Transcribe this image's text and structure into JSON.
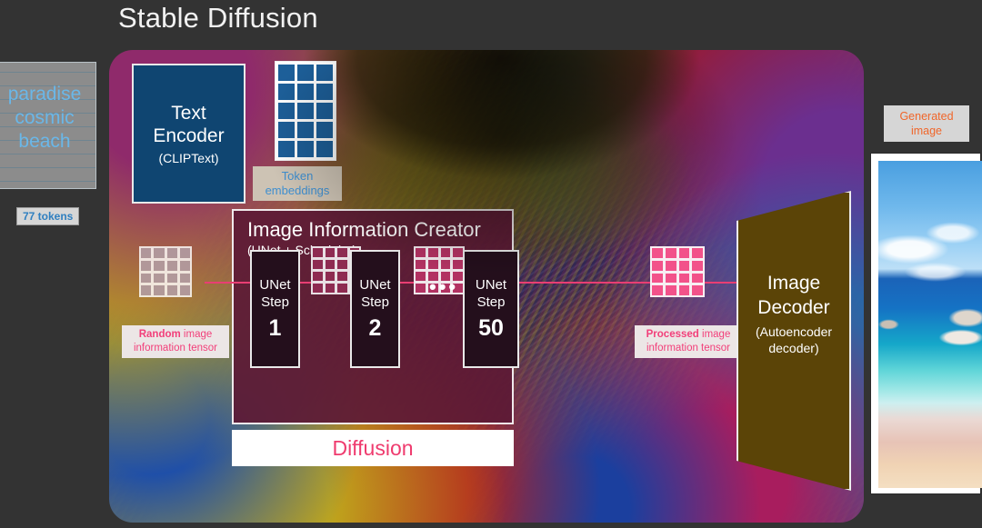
{
  "title": "Stable Diffusion",
  "prompt": {
    "text": "paradise cosmic beach",
    "tokens_badge": "77 tokens"
  },
  "text_encoder": {
    "line1": "Text",
    "line2": "Encoder",
    "subtitle": "(CLIPText)"
  },
  "token_embeddings": {
    "label": "Token embeddings",
    "cols": 3,
    "rows": 5
  },
  "image_information_creator": {
    "title": "Image Information Creator",
    "subtitle": "(UNet + Scheduler)",
    "unet_steps": [
      {
        "line1": "UNet",
        "line2": "Step",
        "number": "1"
      },
      {
        "line1": "UNet",
        "line2": "Step",
        "number": "2"
      },
      {
        "line1": "UNet",
        "line2": "Step",
        "number": "50"
      }
    ],
    "ellipsis": "•••",
    "diffusion_bar": "Diffusion"
  },
  "tensors": {
    "random": {
      "emphasis": "Random",
      "rest": " image information tensor",
      "cols": 4,
      "rows": 4
    },
    "processed": {
      "emphasis": "Processed",
      "rest": " image information tensor",
      "cols": 4,
      "rows": 4
    },
    "latent_cols": 4,
    "latent_rows": 4
  },
  "image_decoder": {
    "line1": "Image",
    "line2": "Decoder",
    "sub1": "(Autoencoder",
    "sub2": "decoder)"
  },
  "generated": {
    "label": "Generated image"
  },
  "colors": {
    "background": "#333333",
    "text_encoder": "#0f4571",
    "token_cell": "#1d5f99",
    "iic_panel": "#5c1a36",
    "unet_box": "#240f1c",
    "flow_arrow": "#e83e73",
    "diffusion_text": "#ef3b6e",
    "decoder": "#5b4407",
    "processed_cell": "#f2528a",
    "prompt_text": "#6ab7e8",
    "generated_label_text": "#f0662a"
  }
}
